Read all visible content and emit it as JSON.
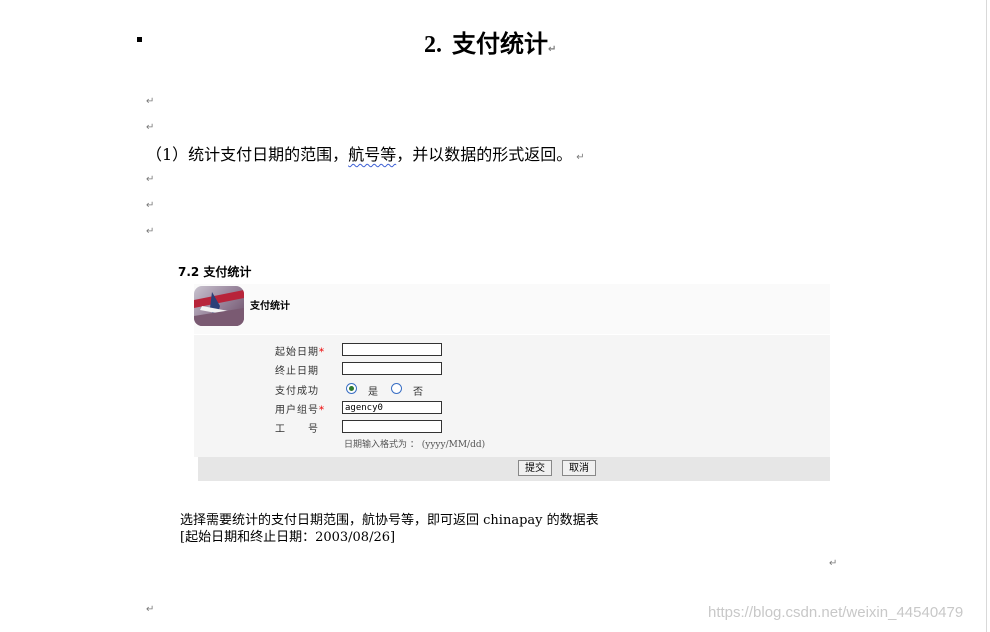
{
  "heading": {
    "number": "2.",
    "text": "支付统计"
  },
  "paragraph": {
    "before": "（1）统计支付日期的范围，",
    "squiggle": "航号等",
    "after": "，并以数据的形式返回。"
  },
  "paragraph_mark": "↵",
  "figure": {
    "caption": "7.2  支付统计",
    "header_title": "支付统计",
    "fields": {
      "start_date_label": "起始日期",
      "end_date_label": "终止日期",
      "pay_success_label": "支付成功",
      "user_group_label": "用户组号",
      "user_group_value": "agency0",
      "job_no_label": "工　　号",
      "required_star": "*"
    },
    "radio": {
      "yes": "是",
      "no": "否",
      "selected": "yes"
    },
    "date_hint": "日期输入格式为 ： (yyyy/MM/dd)",
    "buttons": {
      "submit": "提交",
      "cancel": "取消"
    }
  },
  "description": {
    "line1": "选择需要统计的支付日期范围，航协号等，即可返回 chinapay 的数据表",
    "line2": "[起始日期和终止日期：2003/08/26]"
  },
  "watermark": "https://blog.csdn.net/weixin_44540479"
}
